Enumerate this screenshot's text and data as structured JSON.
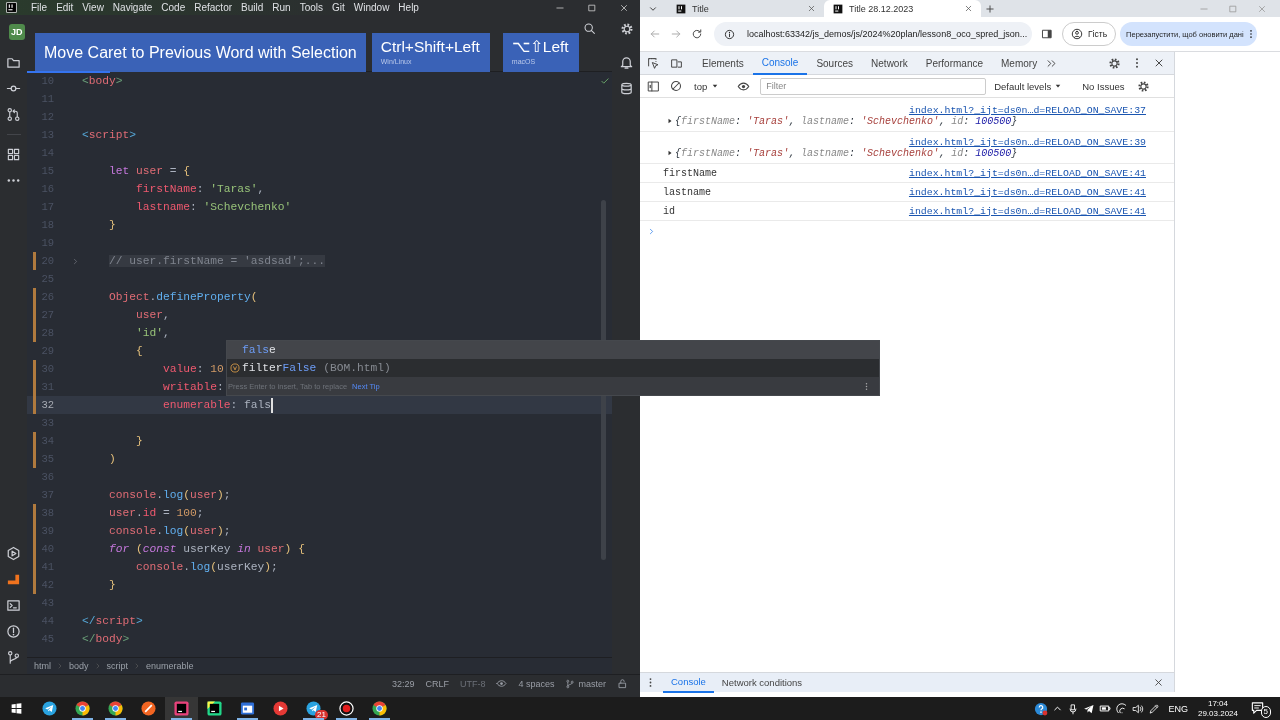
{
  "ide": {
    "menu": [
      "File",
      "Edit",
      "View",
      "Navigate",
      "Code",
      "Refactor",
      "Build",
      "Run",
      "Tools",
      "Git",
      "Window",
      "Help"
    ],
    "project_badge": "JD",
    "shortcut_overlay": {
      "action": "Move Caret to Previous Word with Selection",
      "shortcuts": [
        {
          "keys": "Ctrl+Shift+Left",
          "platform": "Win/Linux"
        },
        {
          "keys": "⌥⇧Left",
          "platform": "macOS"
        }
      ]
    },
    "lines": [
      {
        "number": "10",
        "tokens": [
          {
            "kind": "mark",
            "text": "<"
          },
          {
            "kind": "tag",
            "text": "body"
          },
          {
            "kind": "mark",
            "text": ">"
          }
        ],
        "modified": false,
        "current": false,
        "folded": false,
        "caret": false
      },
      {
        "number": "11",
        "modified": false,
        "current": false,
        "folded": false,
        "caret": false
      },
      {
        "number": "12",
        "modified": false,
        "current": false,
        "folded": false,
        "caret": false
      },
      {
        "number": "13",
        "tokens": [
          {
            "kind": "mark2",
            "text": "<"
          },
          {
            "kind": "tag",
            "text": "script"
          },
          {
            "kind": "mark2",
            "text": ">"
          }
        ],
        "modified": false,
        "current": false,
        "folded": false,
        "caret": false
      },
      {
        "number": "14",
        "modified": false,
        "current": false,
        "folded": false,
        "caret": false
      },
      {
        "number": "15",
        "tokens": [
          {
            "kind": "keyword",
            "text": "    let"
          },
          {
            "kind": "ident",
            "text": " user"
          },
          {
            "kind": "plain",
            "text": " = "
          },
          {
            "kind": "brace",
            "text": "{"
          }
        ],
        "modified": false,
        "current": false,
        "folded": false,
        "caret": false
      },
      {
        "number": "16",
        "tokens": [
          {
            "kind": "prop",
            "text": "        firstName"
          },
          {
            "kind": "plain",
            "text": ": "
          },
          {
            "kind": "string",
            "text": "'Taras'"
          },
          {
            "kind": "plain",
            "text": ","
          }
        ],
        "modified": false,
        "current": false,
        "folded": false,
        "caret": false
      },
      {
        "number": "17",
        "tokens": [
          {
            "kind": "prop",
            "text": "        lastname"
          },
          {
            "kind": "plain",
            "text": ": "
          },
          {
            "kind": "string",
            "text": "'Schevchenko'"
          }
        ],
        "modified": false,
        "current": false,
        "folded": false,
        "caret": false
      },
      {
        "number": "18",
        "tokens": [
          {
            "kind": "brace",
            "text": "    }"
          }
        ],
        "modified": false,
        "current": false,
        "folded": false,
        "caret": false
      },
      {
        "number": "19",
        "modified": false,
        "current": false,
        "folded": false,
        "caret": false
      },
      {
        "number": "20",
        "tokens": [
          {
            "kind": "comment",
            "text": "    // user.firstName = 'asdsad';..."
          }
        ],
        "modified": true,
        "current": false,
        "folded": true,
        "caret": false
      },
      {
        "number": "25",
        "modified": false,
        "current": false,
        "folded": false,
        "caret": false
      },
      {
        "number": "26",
        "tokens": [
          {
            "kind": "ident",
            "text": "    Object"
          },
          {
            "kind": "plain",
            "text": "."
          },
          {
            "kind": "call",
            "text": "defineProperty"
          },
          {
            "kind": "brace",
            "text": "("
          }
        ],
        "modified": true,
        "current": false,
        "folded": false,
        "caret": false
      },
      {
        "number": "27",
        "tokens": [
          {
            "kind": "ident",
            "text": "        user"
          },
          {
            "kind": "plain",
            "text": ","
          }
        ],
        "modified": true,
        "current": false,
        "folded": false,
        "caret": false
      },
      {
        "number": "28",
        "tokens": [
          {
            "kind": "string",
            "text": "        'id'"
          },
          {
            "kind": "plain",
            "text": ","
          }
        ],
        "modified": true,
        "current": false,
        "folded": false,
        "caret": false
      },
      {
        "number": "29",
        "tokens": [
          {
            "kind": "brace",
            "text": "        {"
          }
        ],
        "modified": false,
        "current": false,
        "folded": false,
        "caret": false
      },
      {
        "number": "30",
        "tokens": [
          {
            "kind": "prop",
            "text": "            value"
          },
          {
            "kind": "plain",
            "text": ": "
          },
          {
            "kind": "number",
            "text": "10"
          }
        ],
        "modified": true,
        "current": false,
        "folded": false,
        "caret": false
      },
      {
        "number": "31",
        "tokens": [
          {
            "kind": "prop",
            "text": "            writable"
          },
          {
            "kind": "plain",
            "text": ":"
          }
        ],
        "modified": true,
        "current": false,
        "folded": false,
        "caret": false
      },
      {
        "number": "32",
        "tokens": [
          {
            "kind": "prop",
            "text": "            enumerable"
          },
          {
            "kind": "plain",
            "text": ": "
          },
          {
            "kind": "plain",
            "text": "fals"
          }
        ],
        "modified": true,
        "current": true,
        "folded": false,
        "caret": true
      },
      {
        "number": "33",
        "modified": false,
        "current": false,
        "folded": false,
        "caret": false
      },
      {
        "number": "34",
        "tokens": [
          {
            "kind": "brace",
            "text": "        }"
          }
        ],
        "modified": true,
        "current": false,
        "folded": false,
        "caret": false
      },
      {
        "number": "35",
        "tokens": [
          {
            "kind": "brace",
            "text": "    )"
          }
        ],
        "modified": true,
        "current": false,
        "folded": false,
        "caret": false
      },
      {
        "number": "36",
        "modified": false,
        "current": false,
        "folded": false,
        "caret": false
      },
      {
        "number": "37",
        "tokens": [
          {
            "kind": "ident",
            "text": "    console"
          },
          {
            "kind": "plain",
            "text": "."
          },
          {
            "kind": "call",
            "text": "log"
          },
          {
            "kind": "brace",
            "text": "("
          },
          {
            "kind": "ident",
            "text": "user"
          },
          {
            "kind": "brace",
            "text": ")"
          },
          {
            "kind": "plain",
            "text": ";"
          }
        ],
        "modified": false,
        "current": false,
        "folded": false,
        "caret": false
      },
      {
        "number": "38",
        "tokens": [
          {
            "kind": "ident",
            "text": "    user"
          },
          {
            "kind": "plain",
            "text": "."
          },
          {
            "kind": "prop",
            "text": "id"
          },
          {
            "kind": "plain",
            "text": " = "
          },
          {
            "kind": "number",
            "text": "100"
          },
          {
            "kind": "plain",
            "text": ";"
          }
        ],
        "modified": true,
        "current": false,
        "folded": false,
        "caret": false
      },
      {
        "number": "39",
        "tokens": [
          {
            "kind": "ident",
            "text": "    console"
          },
          {
            "kind": "plain",
            "text": "."
          },
          {
            "kind": "call",
            "text": "log"
          },
          {
            "kind": "brace",
            "text": "("
          },
          {
            "kind": "ident",
            "text": "user"
          },
          {
            "kind": "brace",
            "text": ")"
          },
          {
            "kind": "plain",
            "text": ";"
          }
        ],
        "modified": true,
        "current": false,
        "folded": false,
        "caret": false
      },
      {
        "number": "40",
        "tokens": [
          {
            "kind": "flow",
            "text": "    for"
          },
          {
            "kind": "brace",
            "text": " ("
          },
          {
            "kind": "flow",
            "text": "const"
          },
          {
            "kind": "plain",
            "text": " userKey "
          },
          {
            "kind": "flow",
            "text": "in"
          },
          {
            "kind": "ident",
            "text": " user"
          },
          {
            "kind": "brace",
            "text": ")"
          },
          {
            "kind": "brace",
            "text": " {"
          }
        ],
        "modified": true,
        "current": false,
        "folded": false,
        "caret": false
      },
      {
        "number": "41",
        "tokens": [
          {
            "kind": "ident",
            "text": "        console"
          },
          {
            "kind": "plain",
            "text": "."
          },
          {
            "kind": "call",
            "text": "log"
          },
          {
            "kind": "brace",
            "text": "("
          },
          {
            "kind": "plain",
            "text": "userKey"
          },
          {
            "kind": "brace",
            "text": ")"
          },
          {
            "kind": "plain",
            "text": ";"
          }
        ],
        "modified": true,
        "current": false,
        "folded": false,
        "caret": false
      },
      {
        "number": "42",
        "tokens": [
          {
            "kind": "brace",
            "text": "    }"
          }
        ],
        "modified": true,
        "current": false,
        "folded": false,
        "caret": false
      },
      {
        "number": "43",
        "modified": false,
        "current": false,
        "folded": false,
        "caret": false
      },
      {
        "number": "44",
        "tokens": [
          {
            "kind": "mark2",
            "text": "</"
          },
          {
            "kind": "tag",
            "text": "script"
          },
          {
            "kind": "mark2",
            "text": ">"
          }
        ],
        "modified": false,
        "current": false,
        "folded": false,
        "caret": false
      },
      {
        "number": "45",
        "tokens": [
          {
            "kind": "mark",
            "text": "</"
          },
          {
            "kind": "tag",
            "text": "body"
          },
          {
            "kind": "mark",
            "text": ">"
          }
        ],
        "modified": false,
        "current": false,
        "folded": false,
        "caret": false
      }
    ],
    "completion": {
      "items": [
        {
          "kind": "keyword",
          "parts": [
            {
              "text": "fals",
              "match": true
            },
            {
              "text": "e",
              "match": false
            }
          ],
          "selected": true
        },
        {
          "kind": "variable",
          "parts": [
            {
              "text": "filter",
              "match": false
            },
            {
              "text": "False",
              "match": true
            }
          ],
          "location": "(BOM.html)",
          "selected": false
        }
      ],
      "hint": "Press Enter to insert, Tab to replace",
      "tip_link": "Next Tip"
    },
    "breadcrumbs": [
      "html",
      "body",
      "script",
      "enumerable"
    ],
    "status": {
      "position": "32:29",
      "line_separator": "CRLF",
      "encoding": "UTF-8",
      "indent": "4 spaces",
      "branch": "master"
    }
  },
  "browser": {
    "tabs": [
      {
        "title": "Title",
        "selected": false
      },
      {
        "title": "Title 28.12.2023",
        "selected": true
      }
    ],
    "address": "localhost:63342/js_demos/js/2024%20plan/lesson8_oco_spred_json...",
    "profile": "Гість",
    "update_button": "Перезапустити, щоб оновити дані",
    "devtools": {
      "tabs": [
        {
          "label": "Elements",
          "selected": false
        },
        {
          "label": "Console",
          "selected": true
        },
        {
          "label": "Sources",
          "selected": false
        },
        {
          "label": "Network",
          "selected": false
        },
        {
          "label": "Performance",
          "selected": false
        },
        {
          "label": "Memory",
          "selected": false
        }
      ],
      "context": "top",
      "filter_placeholder": "Filter",
      "levels": "Default levels",
      "issues": "No Issues",
      "messages": [
        {
          "kind": "object",
          "source": "index.html?_ijt=ds0n…d=RELOAD_ON_SAVE:37",
          "segments": [
            {
              "kind": "punct",
              "text": "{"
            },
            {
              "kind": "key",
              "text": "firstName"
            },
            {
              "kind": "punct",
              "text": ": "
            },
            {
              "kind": "string",
              "text": "'Taras'"
            },
            {
              "kind": "punct",
              "text": ", "
            },
            {
              "kind": "key",
              "text": "lastname"
            },
            {
              "kind": "punct",
              "text": ": "
            },
            {
              "kind": "string",
              "text": "'Schevchenko'"
            },
            {
              "kind": "punct",
              "text": ", "
            },
            {
              "kind": "key",
              "text": "id"
            },
            {
              "kind": "punct",
              "text": ": "
            },
            {
              "kind": "number",
              "text": "100500"
            },
            {
              "kind": "punct",
              "text": "}"
            }
          ]
        },
        {
          "kind": "object",
          "source": "index.html?_ijt=ds0n…d=RELOAD_ON_SAVE:39",
          "segments": [
            {
              "kind": "punct",
              "text": "{"
            },
            {
              "kind": "key",
              "text": "firstName"
            },
            {
              "kind": "punct",
              "text": ": "
            },
            {
              "kind": "string",
              "text": "'Taras'"
            },
            {
              "kind": "punct",
              "text": ", "
            },
            {
              "kind": "key",
              "text": "lastname"
            },
            {
              "kind": "punct",
              "text": ": "
            },
            {
              "kind": "string",
              "text": "'Schevchenko'"
            },
            {
              "kind": "punct",
              "text": ", "
            },
            {
              "kind": "key",
              "text": "id"
            },
            {
              "kind": "punct",
              "text": ": "
            },
            {
              "kind": "number",
              "text": "100500"
            },
            {
              "kind": "punct",
              "text": "}"
            }
          ]
        },
        {
          "kind": "text",
          "source": "index.html?_ijt=ds0n…d=RELOAD_ON_SAVE:41",
          "text": "firstName"
        },
        {
          "kind": "text",
          "source": "index.html?_ijt=ds0n…d=RELOAD_ON_SAVE:41",
          "text": "lastname"
        },
        {
          "kind": "text",
          "source": "index.html?_ijt=ds0n…d=RELOAD_ON_SAVE:41",
          "text": "id"
        }
      ],
      "drawer_tabs": [
        {
          "label": "Console",
          "selected": true
        },
        {
          "label": "Network conditions",
          "selected": false
        }
      ]
    }
  },
  "taskbar": {
    "apps": [
      {
        "kind": "plane",
        "selected": false,
        "running": false
      },
      {
        "kind": "chrome",
        "selected": false,
        "running": true
      },
      {
        "kind": "chrome",
        "selected": false,
        "running": true
      },
      {
        "kind": "orange",
        "selected": false,
        "running": false
      },
      {
        "kind": "ide",
        "selected": true,
        "running": true
      },
      {
        "kind": "ide2",
        "selected": false,
        "running": false
      },
      {
        "kind": "calendar",
        "selected": false,
        "running": true
      },
      {
        "kind": "play",
        "selected": false,
        "running": false
      },
      {
        "kind": "plane",
        "selected": false,
        "running": true,
        "badge": "21"
      },
      {
        "kind": "record",
        "selected": false,
        "running": true
      },
      {
        "kind": "chrome",
        "selected": false,
        "running": true
      }
    ],
    "language": "ENG",
    "time": "17:04",
    "date": "29.03.2024",
    "notifications": "5"
  }
}
